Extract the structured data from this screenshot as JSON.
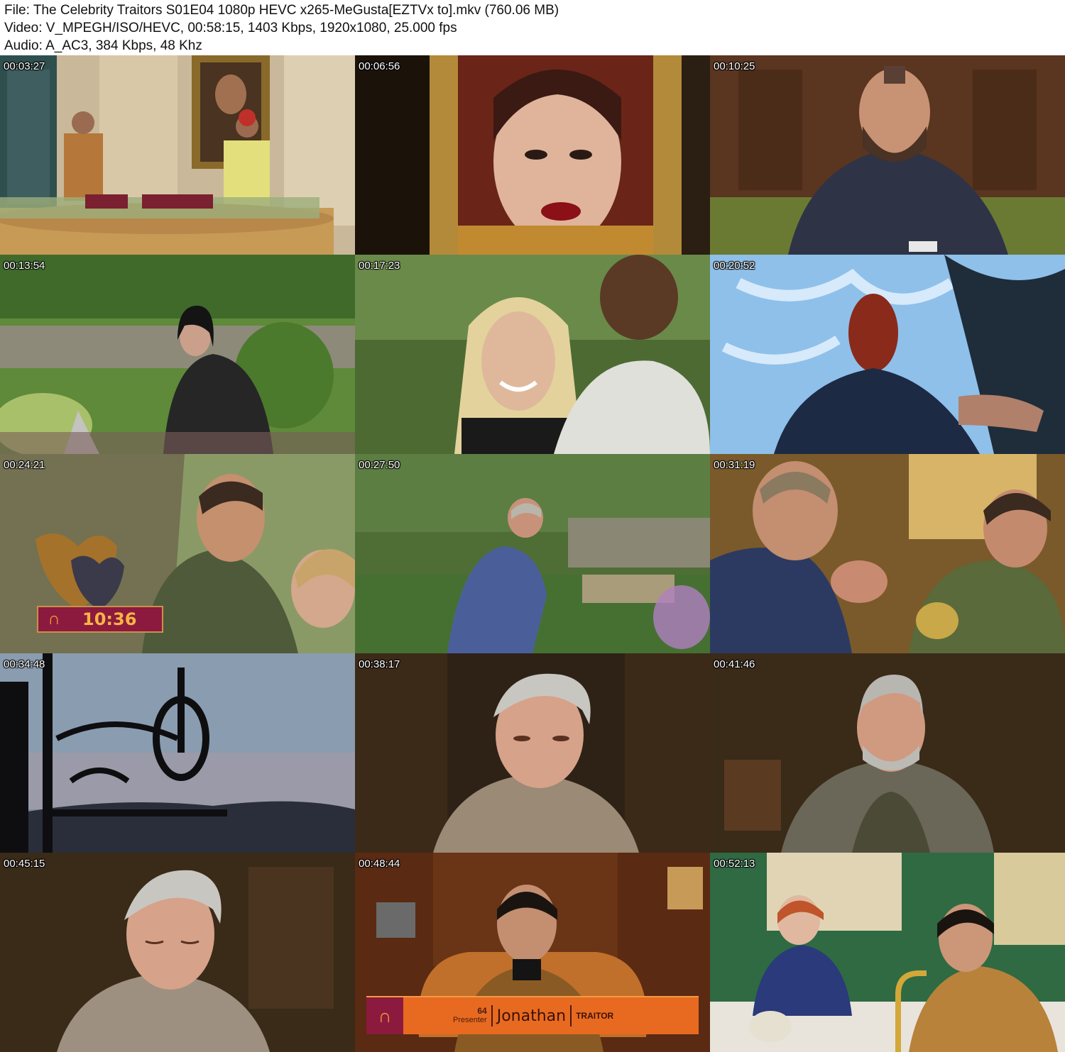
{
  "header": {
    "file_line": "File: The Celebrity Traitors S01E04 1080p HEVC x265-MeGusta[EZTVx to].mkv (760.06 MB)",
    "video_line": "Video: V_MPEGH/ISO/HEVC, 00:58:15, 1403 Kbps, 1920x1080, 25.000 fps",
    "audio_line": "Audio: A_AC3, 384 Kbps, 48 Khz"
  },
  "thumbnails": [
    {
      "timestamp": "00:03:27"
    },
    {
      "timestamp": "00:06:56"
    },
    {
      "timestamp": "00:10:25"
    },
    {
      "timestamp": "00:13:54"
    },
    {
      "timestamp": "00:17:23"
    },
    {
      "timestamp": "00:20:52"
    },
    {
      "timestamp": "00:24:21",
      "overlay_time": "10:36"
    },
    {
      "timestamp": "00:27:50"
    },
    {
      "timestamp": "00:31:19"
    },
    {
      "timestamp": "00:34:48"
    },
    {
      "timestamp": "00:38:17"
    },
    {
      "timestamp": "00:41:46"
    },
    {
      "timestamp": "00:45:15"
    },
    {
      "timestamp": "00:48:44",
      "overlay_age": "64",
      "overlay_title": "Presenter",
      "overlay_name": "Jonathan",
      "overlay_role": "TRAITOR"
    },
    {
      "timestamp": "00:52:13"
    }
  ],
  "colors": {
    "timer_bg": "#8c1a3e",
    "timer_text": "#f6b544",
    "name_bar": "#e86a20"
  }
}
